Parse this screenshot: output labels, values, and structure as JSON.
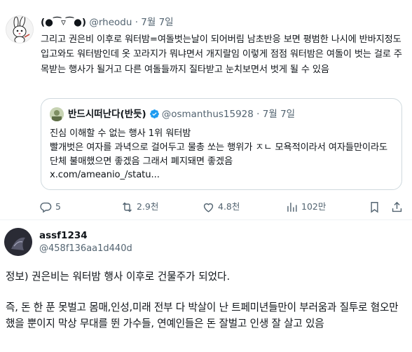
{
  "tweet": {
    "display_name": "(●⁀▿⁀●)",
    "handle": "@rheodu",
    "dot": "·",
    "date": "7월 7일",
    "text": "그리고 권은비 이후로 워터밤=여돌벗는날이 되어버림 남초반응 보면 평범한 나시에 반바지정도 입고와도 워터밤인데 옷 꼬라지가 뭐냐면서 개지랄임 이렇게 점점 워터밤은 여돌이 벗는 걸로 주목받는 행사가 될거고 다른 여돌들까지 질타받고 눈치보면서 벗게 될 수 있음"
  },
  "quote": {
    "display_name": "반드시떠난다(반듯)",
    "handle": "@osmanthus15928",
    "dot": "·",
    "date": "7월 7일",
    "line1": "진심 이해할 수 없는 행사 1위 워터밤",
    "line2": "빨개벗은 여자를 과녁으로 걸어두고 물총 쏘는 행위가 ㅈㄴ 모욕적이라서 여자들만이라도 단체 불매했으면 좋겠음 그래서 폐지돼면 좋겠음",
    "link": "x.com/ameanio_/statu..."
  },
  "actions": {
    "replies": "5",
    "reposts": "2.9천",
    "likes": "4.8천",
    "views": "102만"
  },
  "reply": {
    "display_name": "assf1234",
    "handle": "@458f136aa1d440d",
    "line1": "정보) 권은비는 워터밤 행사 이후로 건물주가 되었다.",
    "body": "즉, 돈 한 푼 못벌고 몸매,인성,미래 전부 다 박살이 난 트페미년들만이 부러움과 질투로 혐오만 했을 뿐이지 막상 무대를 뛴 가수들, 연예인들은 돈 잘벌고 인생 잘 살고 있음"
  },
  "colors": {
    "text": "#0f1419",
    "secondary": "#536471",
    "border": "#cfd9de",
    "verified": "#1d9bf0"
  }
}
